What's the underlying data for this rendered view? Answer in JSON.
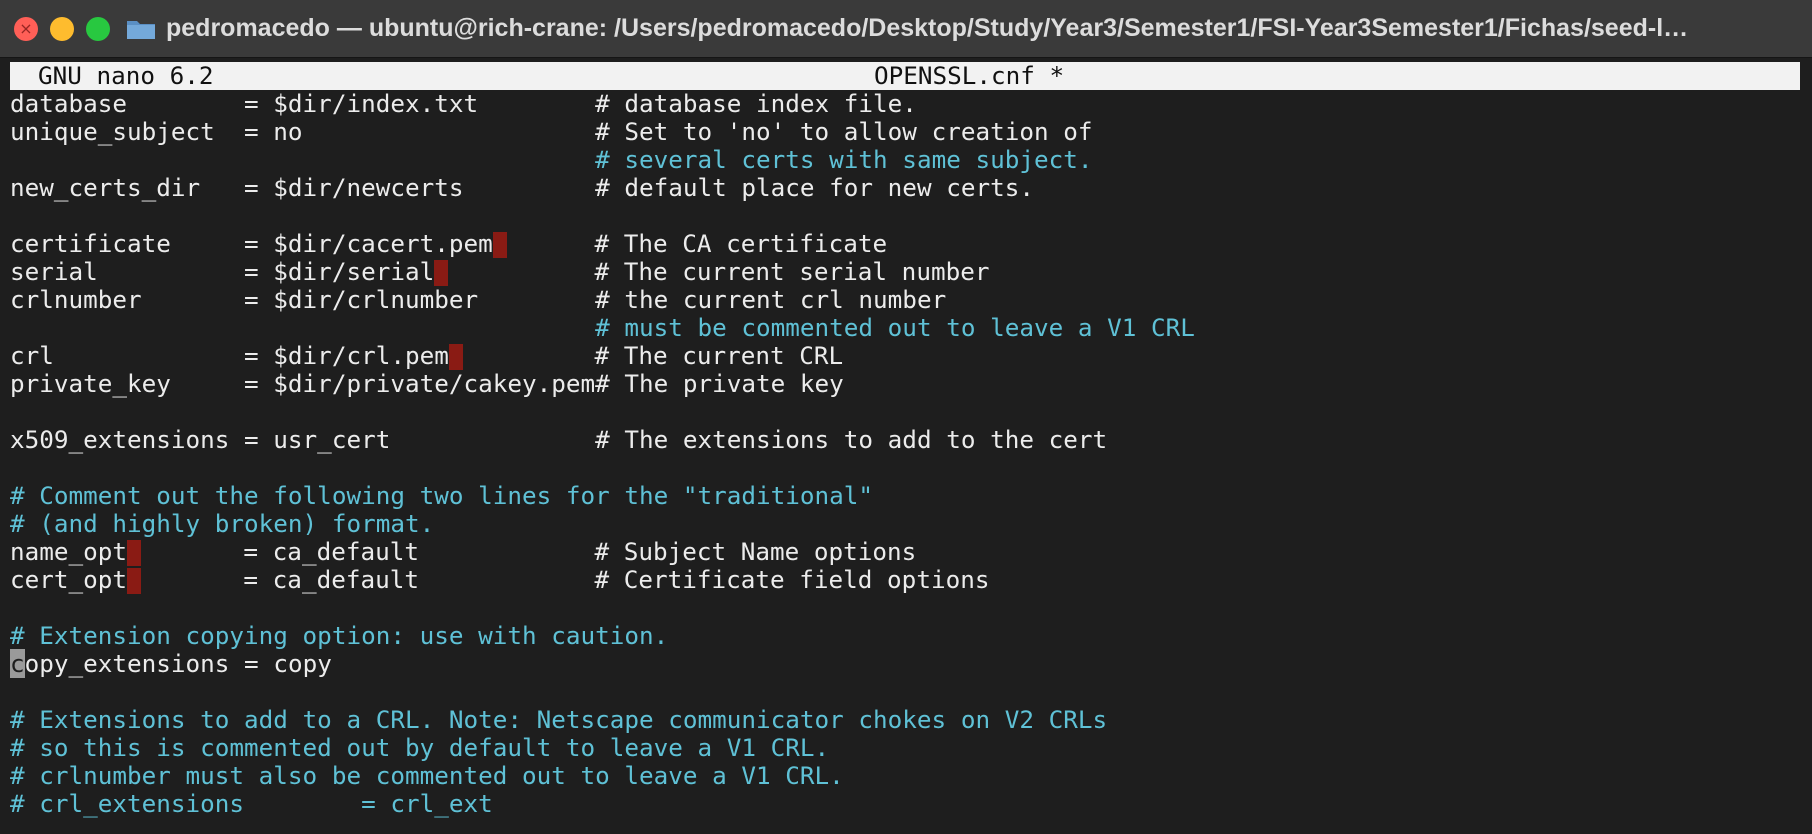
{
  "window": {
    "title": "pedromacedo — ubuntu@rich-crane: /Users/pedromacedo/Desktop/Study/Year3/Semester1/FSI-Year3Semester1/Fichas/seed-l…",
    "icons": {
      "close": "close-icon",
      "minimize": "minimize-icon",
      "maximize": "maximize-icon",
      "folder": "folder-icon"
    },
    "traffic_light_colors": {
      "close": "#ff5f57",
      "minimize": "#febc2e",
      "maximize": "#28c840"
    }
  },
  "nano": {
    "program": "GNU nano 6.2",
    "filename": "OPENSSL.cnf *"
  },
  "editor": {
    "comment_color": "#5fc1d6",
    "text_color": "#ececec",
    "lines": {
      "l1_key": "database        = $dir/index.txt        ",
      "l1_comment": "# database index file.",
      "l2_key": "unique_subject  = no                    ",
      "l2_comment": "# Set to 'no' to allow creation of",
      "l3_pad": "                                        ",
      "l3_comment": "# several certs with same subject.",
      "l4_key": "new_certs_dir   = $dir/newcerts         ",
      "l4_comment": "# default place for new certs.",
      "l6_key": "certificate     = $dir/cacert.pem",
      "l6_pad": "      ",
      "l6_comment": "# The CA certificate",
      "l7_key": "serial          = $dir/serial",
      "l7_pad": "          ",
      "l7_comment": "# The current serial number",
      "l8_key": "crlnumber       = $dir/crlnumber        ",
      "l8_comment": "# the current crl number",
      "l9_pad": "                                        ",
      "l9_comment": "# must be commented out to leave a V1 CRL",
      "l10_key": "crl             = $dir/crl.pem",
      "l10_pad": "         ",
      "l10_comment": "# The current CRL",
      "l11_key": "private_key     = $dir/private/cakey.pem",
      "l11_comment": "# The private key",
      "l13_key": "x509_extensions = usr_cert              ",
      "l13_comment": "# The extensions to add to the cert",
      "l15_comment": "# Comment out the following two lines for the \"traditional\"",
      "l16_comment": "# (and highly broken) format.",
      "l17_key": "name_opt",
      "l17_rest": "       = ca_default            ",
      "l17_comment": "# Subject Name options",
      "l18_key": "cert_opt",
      "l18_rest": "       = ca_default            ",
      "l18_comment": "# Certificate field options",
      "l20_comment": "# Extension copying option: use with caution.",
      "l21_caret": "c",
      "l21_rest": "opy_extensions = copy",
      "l23_comment": "# Extensions to add to a CRL. Note: Netscape communicator chokes on V2 CRLs",
      "l24_comment": "# so this is commented out by default to leave a V1 CRL.",
      "l25_comment": "# crlnumber must also be commented out to leave a V1 CRL.",
      "l26_comment": "# crl_extensions        = crl_ext"
    }
  }
}
